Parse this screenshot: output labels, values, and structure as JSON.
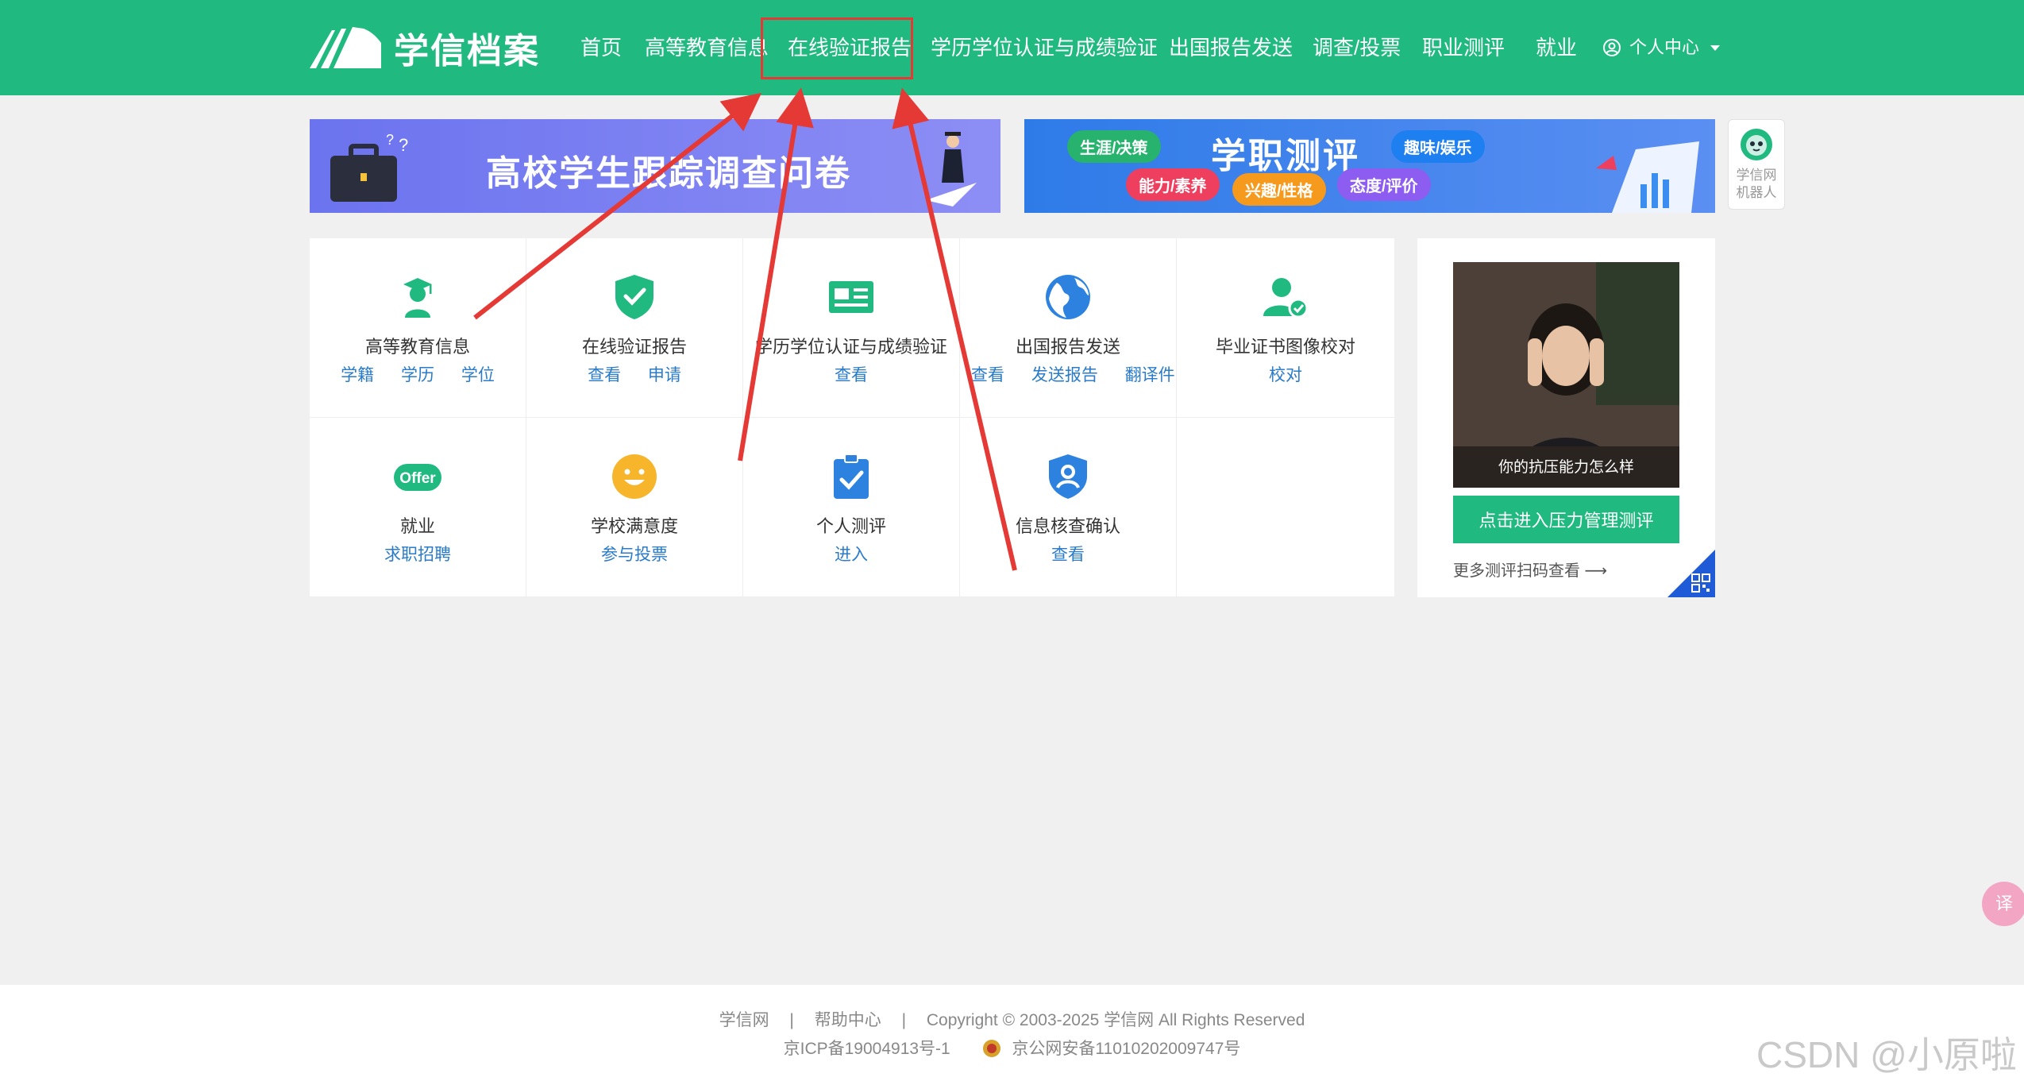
{
  "header": {
    "logo_text": "学信档案",
    "nav": [
      {
        "label": "首页"
      },
      {
        "label": "高等教育信息"
      },
      {
        "label": "在线验证报告"
      },
      {
        "label": "学历学位认证与成绩验证"
      },
      {
        "label": "出国报告发送"
      },
      {
        "label": "调查/投票"
      },
      {
        "label": "职业测评"
      },
      {
        "label": "就业"
      }
    ],
    "user_menu": "个人中心"
  },
  "banners": {
    "left_title": "高校学生跟踪调查问卷",
    "right_title": "学职测评",
    "right_tags": [
      "生涯/决策",
      "趣味/娱乐",
      "能力/素养",
      "兴趣/性格",
      "态度/评价"
    ]
  },
  "robot": {
    "label_line1": "学信网",
    "label_line2": "机器人"
  },
  "grid": {
    "cells": [
      {
        "title": "高等教育信息",
        "icon": "graduate-icon",
        "links": [
          "学籍",
          "学历",
          "学位"
        ]
      },
      {
        "title": "在线验证报告",
        "icon": "shield-check-icon",
        "links": [
          "查看",
          "申请"
        ]
      },
      {
        "title": "学历学位认证与成绩验证",
        "icon": "id-card-icon",
        "links": [
          "查看"
        ]
      },
      {
        "title": "出国报告发送",
        "icon": "globe-icon",
        "links": [
          "查看",
          "发送报告",
          "翻译件"
        ]
      },
      {
        "title": "毕业证书图像校对",
        "icon": "user-check-icon",
        "links": [
          "校对"
        ]
      },
      {
        "title": "就业",
        "icon": "offer-icon",
        "links": [
          "求职招聘"
        ]
      },
      {
        "title": "学校满意度",
        "icon": "smile-icon",
        "links": [
          "参与投票"
        ]
      },
      {
        "title": "个人测评",
        "icon": "clipboard-check-icon",
        "links": [
          "进入"
        ]
      },
      {
        "title": "信息核查确认",
        "icon": "shield-user-icon",
        "links": [
          "查看"
        ]
      }
    ]
  },
  "side": {
    "caption": "你的抗压能力怎么样",
    "button": "点击进入压力管理测评",
    "more": "更多测评扫码查看 ⟶"
  },
  "footer": {
    "link1": "学信网",
    "link2": "帮助中心",
    "copyright": "Copyright © 2003-2025 学信网 All Rights Reserved",
    "icp": "京ICP备19004913号-1",
    "police": "京公网安备11010202009747号"
  },
  "watermark": "CSDN @小原啦",
  "translate_label": "译",
  "colors": {
    "brand": "#20b980",
    "link": "#2a7bc8",
    "annotation": "#e53935"
  }
}
